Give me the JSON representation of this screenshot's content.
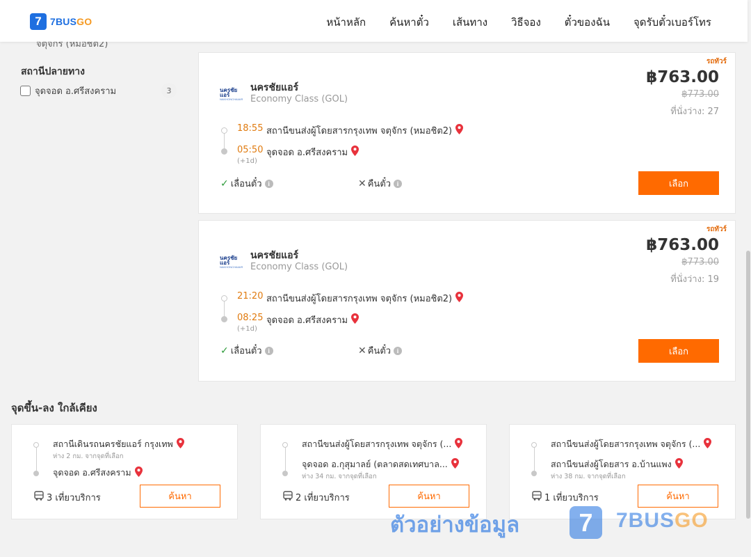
{
  "header": {
    "logo_mark": "7",
    "logo_text_a": "7BUS",
    "logo_text_b": "GO",
    "nav": [
      "หน้าหลัก",
      "ค้นหาตั๋ว",
      "เส้นทาง",
      "วิธีจอง",
      "ตั๋วของฉัน",
      "จุดรับตั๋วเบอร์โทร"
    ]
  },
  "sidebar": {
    "cut_item": "จตุจักร (หมอชิต2)",
    "section_title": "สถานีปลายทาง",
    "filters": [
      {
        "label": "จุดจอด อ.ศรีสงคราม",
        "count": "3"
      }
    ]
  },
  "trips": [
    {
      "badge": "รถทัวร์",
      "operator_name": "นครชัยแอร์",
      "operator_logo_a": "นครชัยแอร์",
      "operator_logo_b": "NAKHONCHAIAIR",
      "bus_class": "Economy Class (GOL)",
      "price": "฿763.00",
      "old_price": "฿773.00",
      "seats": "ที่นั่งว่าง: 27",
      "depart_time": "18:55",
      "depart_station": "สถานีขนส่งผู้โดยสารกรุงเทพ จตุจักร (หมอชิต2)",
      "arrive_time": "05:50",
      "arrive_station": "จุดจอด อ.ศรีสงคราม",
      "next_day": "(+1d)",
      "reschedule": "เลื่อนตั๋ว",
      "refund": "คืนตั๋ว",
      "select_label": "เลือก"
    },
    {
      "badge": "รถทัวร์",
      "operator_name": "นครชัยแอร์",
      "operator_logo_a": "นครชัยแอร์",
      "operator_logo_b": "NAKHONCHAIAIR",
      "bus_class": "Economy Class (GOL)",
      "price": "฿763.00",
      "old_price": "฿773.00",
      "seats": "ที่นั่งว่าง: 19",
      "depart_time": "21:20",
      "depart_station": "สถานีขนส่งผู้โดยสารกรุงเทพ จตุจักร (หมอชิต2)",
      "arrive_time": "08:25",
      "arrive_station": "จุดจอด อ.ศรีสงคราม",
      "next_day": "(+1d)",
      "reschedule": "เลื่อนตั๋ว",
      "refund": "คืนตั๋ว",
      "select_label": "เลือก"
    }
  ],
  "nearby": {
    "title": "จุดขึ้น-ลง ใกล้เคียง",
    "cards": [
      {
        "from_name": "สถานีเดินรถนครชัยแอร์ กรุงเทพ",
        "from_distance": "ห่าง 2 กม. จากจุดที่เลือก",
        "to_name": "จุดจอด อ.ศรีสงคราม",
        "to_distance": "",
        "trips": "3 เที่ยวบริการ",
        "search_label": "ค้นหา"
      },
      {
        "from_name": "สถานีขนส่งผู้โดยสารกรุงเทพ จตุจักร (...",
        "from_distance": "",
        "to_name": "จุดจอด อ.กุสุมาลย์ (ตลาดสดเทศบาล...",
        "to_distance": "ห่าง 34 กม. จากจุดที่เลือก",
        "trips": "2 เที่ยวบริการ",
        "search_label": "ค้นหา"
      },
      {
        "from_name": "สถานีขนส่งผู้โดยสารกรุงเทพ จตุจักร (...",
        "from_distance": "",
        "to_name": "สถานีขนส่งผู้โดยสาร อ.บ้านแพง",
        "to_distance": "ห่าง 38 กม. จากจุดที่เลือก",
        "trips": "1 เที่ยวบริการ",
        "search_label": "ค้นหา"
      }
    ]
  },
  "watermark": {
    "text": "ตัวอย่างข้อมูล",
    "logo_mark": "7",
    "brand_a": "7BUS",
    "brand_b": "GO"
  },
  "colors": {
    "accent": "#ff6a00",
    "time": "#e07b10",
    "brand_blue": "#1e6fe0",
    "brand_orange": "#f59a23",
    "pin": "#e8323c"
  }
}
